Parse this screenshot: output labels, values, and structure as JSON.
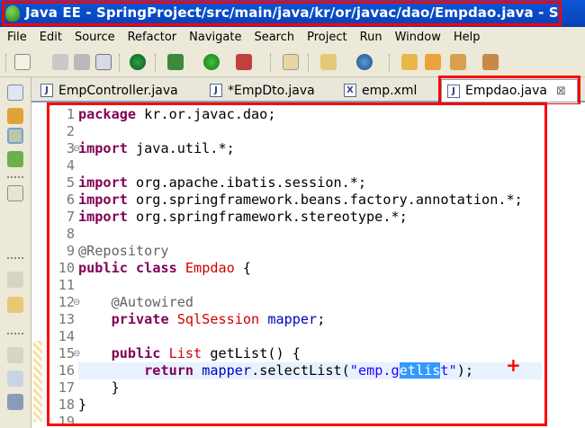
{
  "window": {
    "title": "Java EE - SpringProject/src/main/java/kr/or/javac/dao/Empdao.java - S"
  },
  "menu": [
    "File",
    "Edit",
    "Source",
    "Refactor",
    "Navigate",
    "Search",
    "Project",
    "Run",
    "Window",
    "Help"
  ],
  "tabs": [
    {
      "label": "EmpController.java",
      "icon": "J"
    },
    {
      "label": "*EmpDto.java",
      "icon": "J"
    },
    {
      "label": "emp.xml",
      "icon": "X"
    },
    {
      "label": "Empdao.java",
      "icon": "J",
      "close": "⊠"
    }
  ],
  "code": {
    "line_numbers": [
      "1",
      "2",
      "3",
      "4",
      "5",
      "6",
      "7",
      "8",
      "9",
      "10",
      "11",
      "12",
      "13",
      "14",
      "15",
      "16",
      "17",
      "18",
      "19"
    ],
    "l1_kw": "package",
    "l1_rest": " kr.or.javac.dao;",
    "l3_kw": "import",
    "l3_rest": " java.util.*;",
    "l5_kw": "import",
    "l5_rest": " org.apache.ibatis.session.*;",
    "l6_kw": "import",
    "l6_rest": " org.springframework.beans.factory.annotation.*;",
    "l7_kw": "import",
    "l7_rest": " org.springframework.stereotype.*;",
    "l9_ann": "@Repository",
    "l10_kw1": "public",
    "l10_kw2": "class",
    "l10_name": "Empdao",
    "l10_rest": " {",
    "l12_ann": "@Autowired",
    "l13_kw": "private",
    "l13_type": "SqlSession",
    "l13_field": "mapper",
    "l13_semi": ";",
    "l15_kw": "public",
    "l15_type": "List",
    "l15_rest": " getList() {",
    "l16_kw": "return",
    "l16_field": "mapper",
    "l16_call": ".selectList(",
    "l16_str_a": "\"emp.g",
    "l16_sel": "etlis",
    "l16_str_b": "t\"",
    "l16_end": ");",
    "l17": "}",
    "l18": "}"
  },
  "annotation": {
    "plus": "+"
  }
}
